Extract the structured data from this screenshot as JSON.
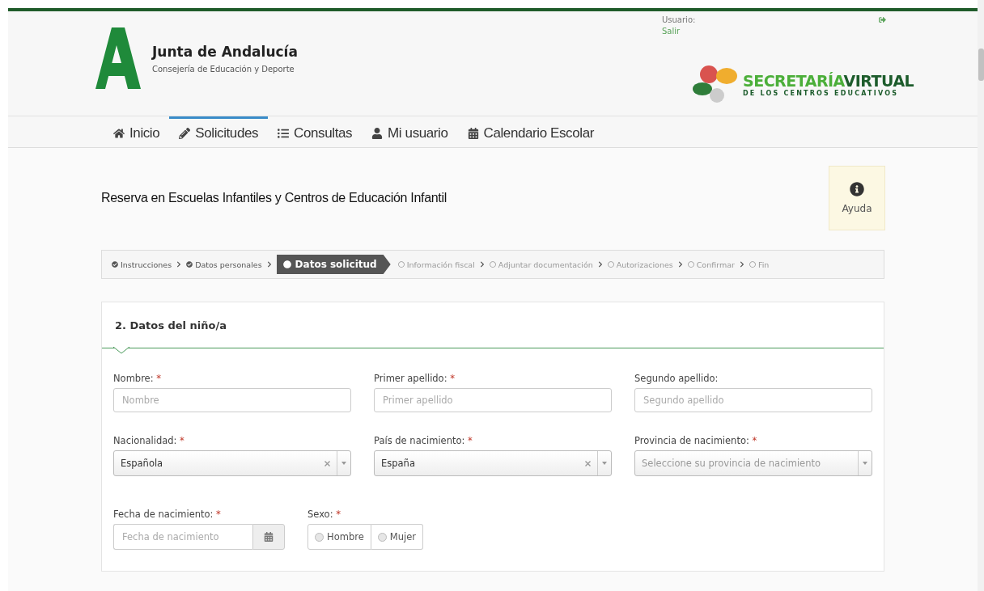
{
  "header": {
    "org_title": "Junta de Andalucía",
    "org_subtitle": "Consejería de Educación y Deporte",
    "user_label": "Usuario:",
    "logout_link": "Salir",
    "brand_title_1": "SECRETARÍA",
    "brand_title_2": "VIRTUAL",
    "brand_subtitle": "DE LOS CENTROS EDUCATIVOS"
  },
  "nav": [
    {
      "label": "Inicio",
      "selected": false
    },
    {
      "label": "Solicitudes",
      "selected": true
    },
    {
      "label": "Consultas",
      "selected": false
    },
    {
      "label": "Mi usuario",
      "selected": false
    },
    {
      "label": "Calendario Escolar",
      "selected": false
    }
  ],
  "page_title": "Reserva en Escuelas Infantiles y Centros de Educación Infantil",
  "help_button": "Ayuda",
  "steps": [
    {
      "label": "Instrucciones",
      "kind": "done"
    },
    {
      "label": "Datos personales",
      "kind": "done"
    },
    {
      "label": "Datos solicitud",
      "kind": "current"
    },
    {
      "label": "Información fiscal",
      "kind": "pending"
    },
    {
      "label": "Adjuntar documentación",
      "kind": "pending"
    },
    {
      "label": "Autorizaciones",
      "kind": "pending"
    },
    {
      "label": "Confirmar",
      "kind": "pending"
    },
    {
      "label": "Fin",
      "kind": "pending"
    }
  ],
  "section": {
    "title": "2. Datos del niño/a",
    "rows": [
      [
        {
          "label": "Nombre:",
          "required_mark": "*",
          "kind": "text",
          "placeholder": "Nombre"
        },
        {
          "label": "Primer apellido:",
          "required_mark": "*",
          "kind": "text",
          "placeholder": "Primer apellido"
        },
        {
          "label": "Segundo apellido:",
          "kind": "text",
          "placeholder": "Segundo apellido"
        }
      ],
      [
        {
          "label": "Nacionalidad:",
          "required_mark": "*",
          "kind": "select",
          "value": "Española"
        },
        {
          "label": "País de nacimiento:",
          "required_mark": "*",
          "kind": "select",
          "value": "España"
        },
        {
          "label": "Provincia de nacimiento:",
          "required_mark": "*",
          "kind": "select",
          "placeholder": "Seleccione su provincia de nacimiento"
        }
      ]
    ],
    "birth_date": {
      "label": "Fecha de nacimiento:",
      "required_mark": "*",
      "placeholder": "Fecha de nacimiento"
    },
    "sex": {
      "label": "Sexo:",
      "required_mark": "*",
      "options": [
        {
          "label": "Hombre",
          "selected": false
        },
        {
          "label": "Mujer",
          "selected": false
        }
      ]
    }
  }
}
